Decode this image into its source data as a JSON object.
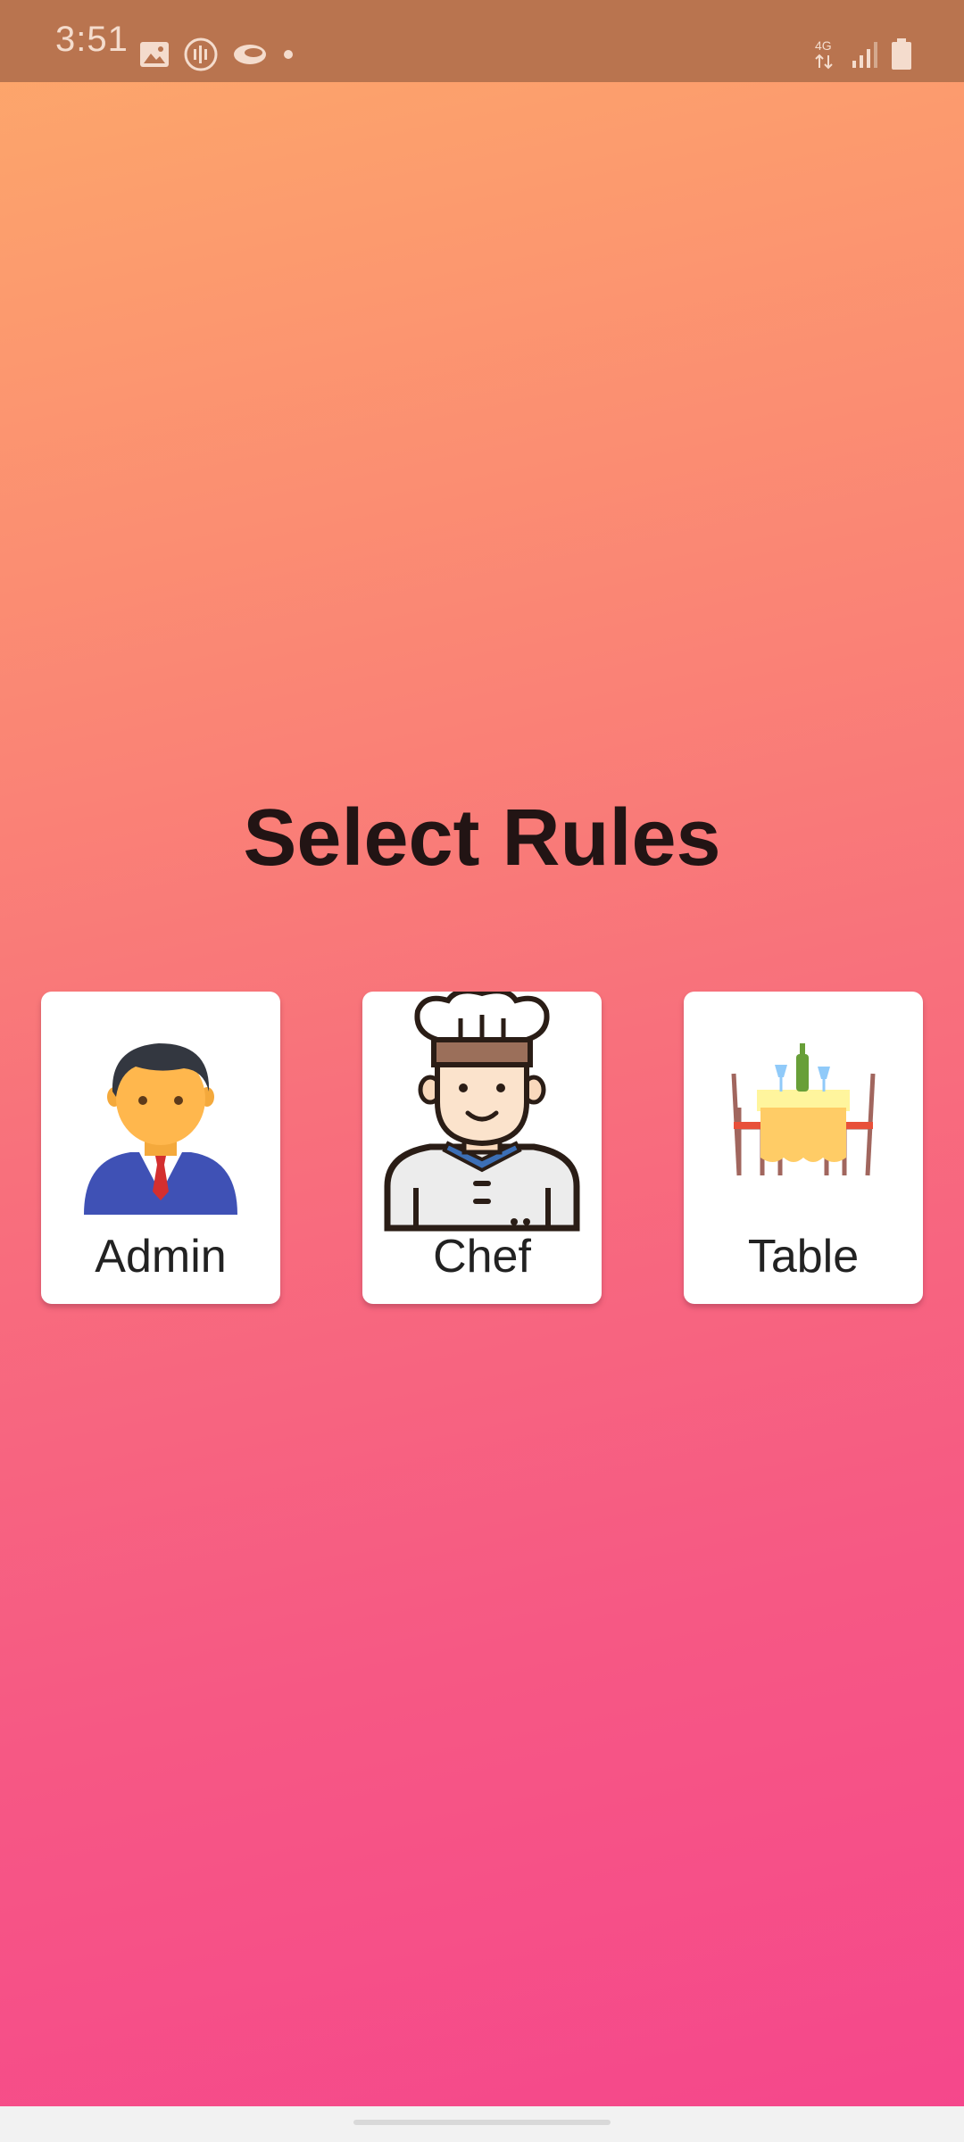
{
  "status_bar": {
    "time": "3:51",
    "network_label": "4G",
    "left_icons": [
      "image-notification-icon",
      "audio-app-icon",
      "cloud-app-icon",
      "more-notifications-dot-icon"
    ],
    "right_icons": [
      "network-4g-icon",
      "signal-strength-icon",
      "battery-icon"
    ]
  },
  "main": {
    "title": "Select Rules"
  },
  "roles": [
    {
      "label": "Admin",
      "icon": "admin-person-icon"
    },
    {
      "label": "Chef",
      "icon": "chef-person-icon"
    },
    {
      "label": "Table",
      "icon": "dining-table-icon"
    }
  ],
  "colors": {
    "gradient_top": "#fda96a",
    "gradient_bottom": "#f5468c",
    "status_bar": "#b9744f",
    "title_text": "#221414",
    "card_background": "#ffffff"
  }
}
